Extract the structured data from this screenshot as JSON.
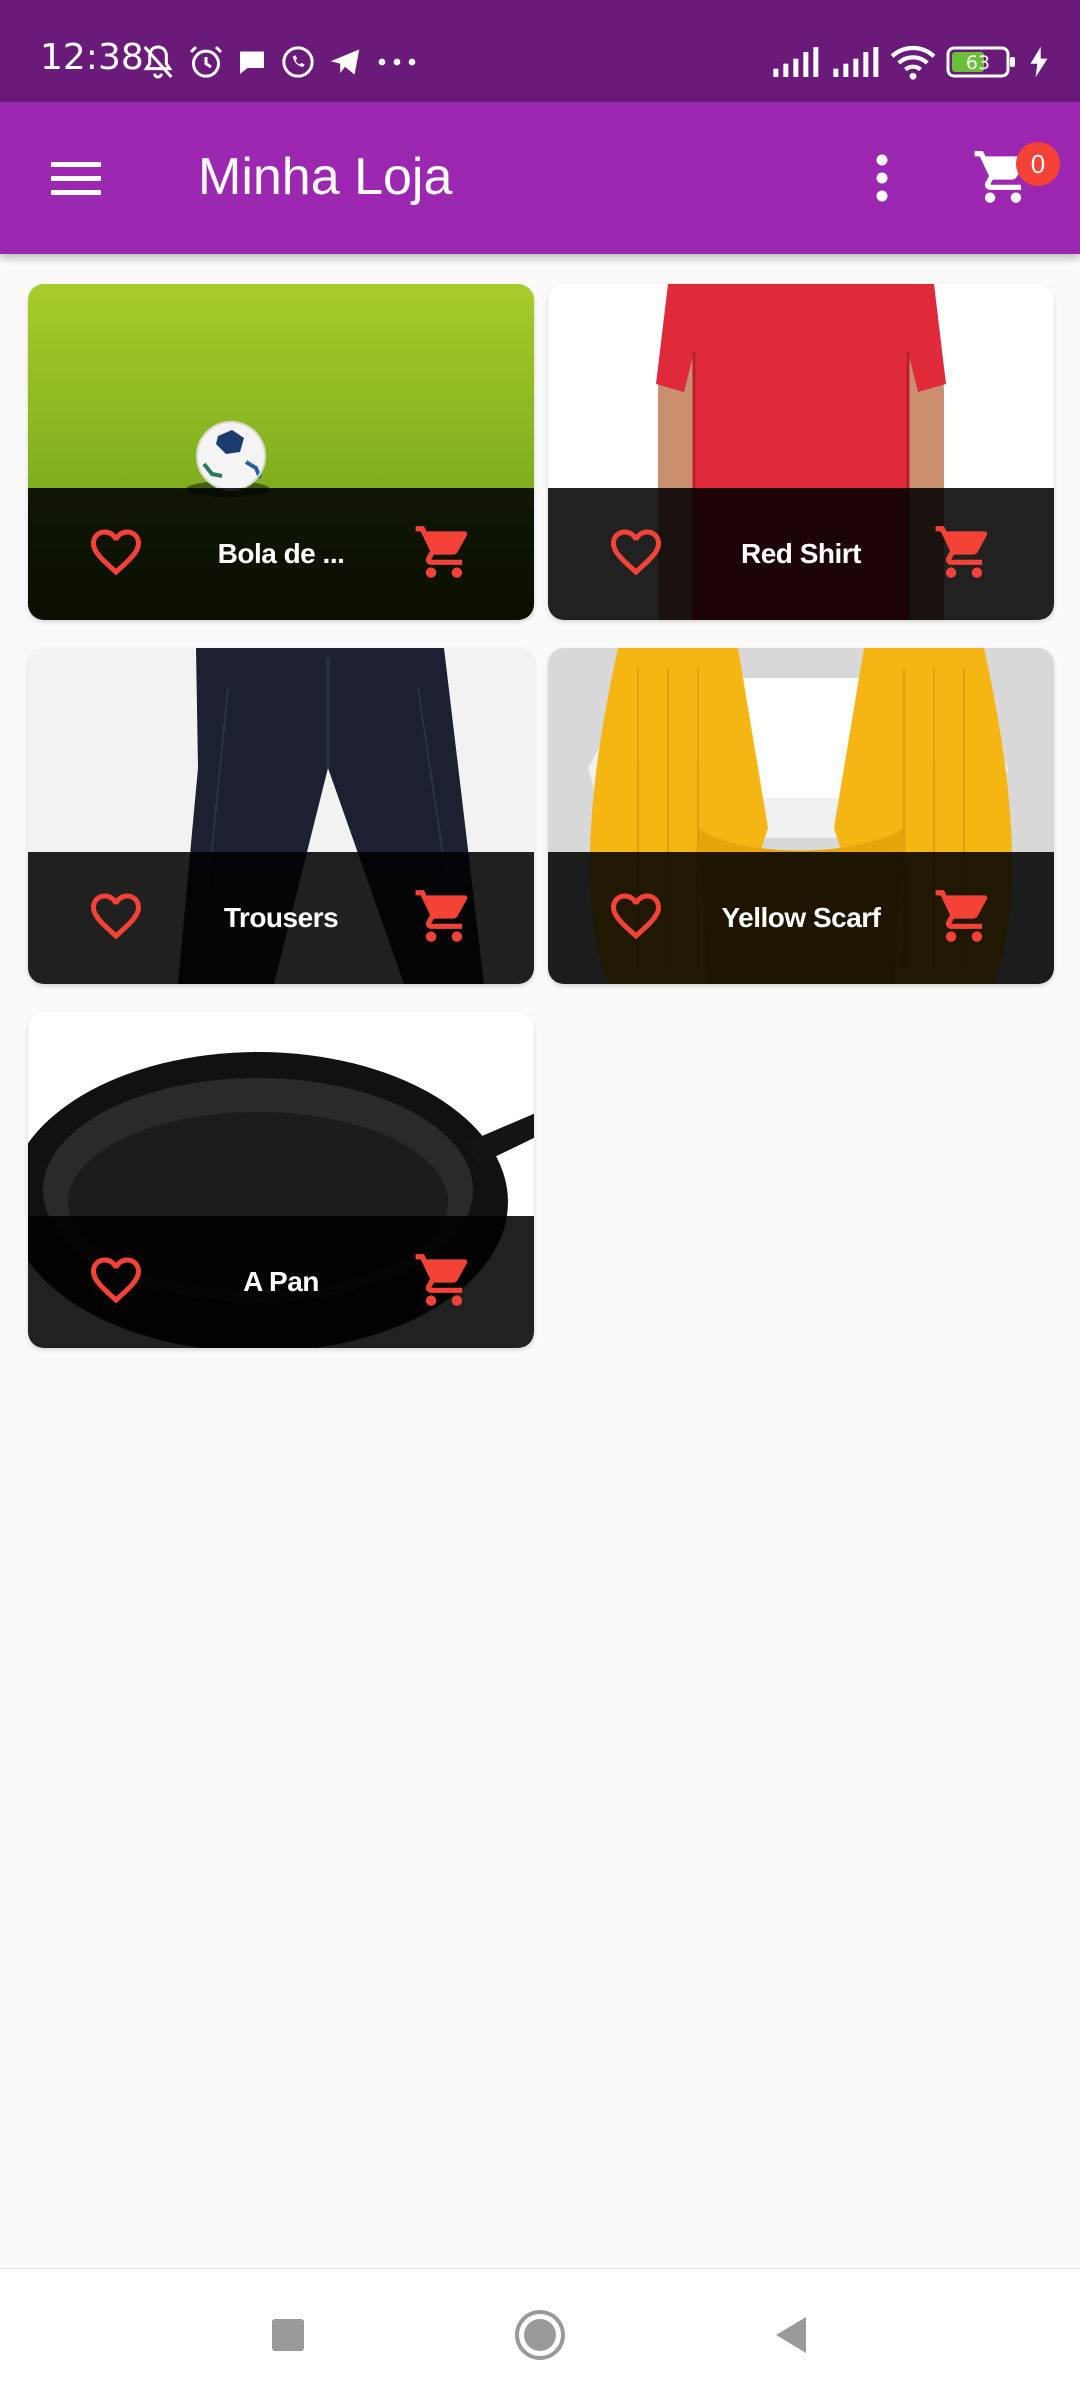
{
  "status_bar": {
    "time": "12:38",
    "battery_level": "63",
    "icons_left": [
      "muted-bell-icon",
      "alarm-icon",
      "chat-bubble-icon",
      "whatsapp-icon",
      "telegram-icon",
      "more-dots-icon"
    ],
    "icons_right": [
      "signal-icon",
      "signal-icon",
      "wifi-icon",
      "battery-icon",
      "charging-icon"
    ]
  },
  "app_bar": {
    "title": "Minha Loja",
    "cart_count": "0",
    "menu_icon": "hamburger-menu-icon",
    "more_icon": "more-vert-icon",
    "cart_icon": "shopping-cart-icon"
  },
  "products": [
    {
      "title": "Bola de ...",
      "image": "soccer-ball-on-grass"
    },
    {
      "title": "Red Shirt",
      "image": "red-t-shirt"
    },
    {
      "title": "Trousers",
      "image": "dark-trousers"
    },
    {
      "title": "Yellow Scarf",
      "image": "yellow-knit-scarf"
    },
    {
      "title": "A Pan",
      "image": "cast-iron-pan"
    }
  ],
  "colors": {
    "status_bar": "#6a1b7a",
    "app_bar": "#9c27b0",
    "accent": "#f44336",
    "card_footer": "#1e1e1e",
    "background": "#fafafa"
  },
  "nav_bar": {
    "items": [
      "recent-apps-icon",
      "home-icon",
      "back-icon"
    ]
  }
}
